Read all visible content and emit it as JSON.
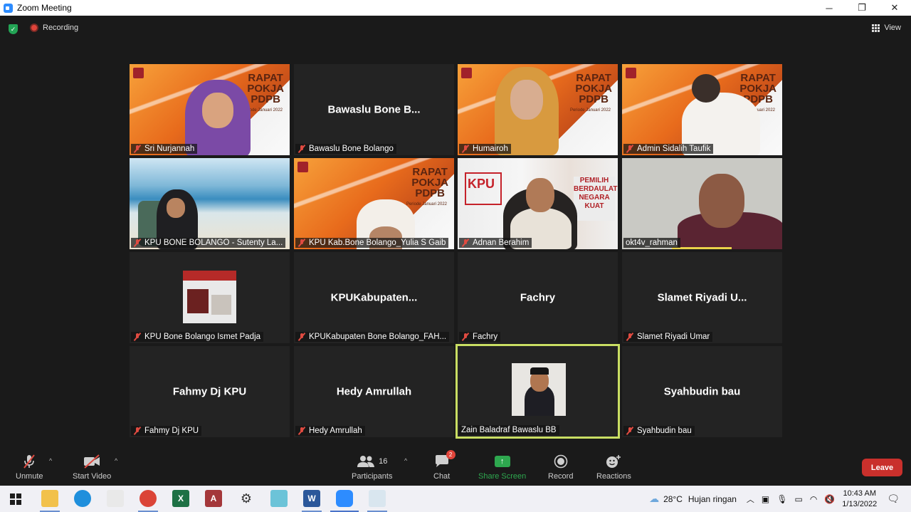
{
  "window": {
    "title": "Zoom Meeting",
    "minimize": "─",
    "maximize": "❐",
    "close": "✕"
  },
  "top": {
    "recording": "Recording",
    "view": "View"
  },
  "tiles": [
    {
      "name": "Sri Nurjannah",
      "banner": "RAPAT\nPOKJA\nPDPB",
      "banner_sub": "Periode Januari 2022"
    },
    {
      "name": "Bawaslu Bone Bolango",
      "center": "Bawaslu Bone B..."
    },
    {
      "name": "Humairoh",
      "banner": "RAPAT\nPOKJA\nPDPB",
      "banner_sub": "Periode Januari 2022"
    },
    {
      "name": "Admin Sidalih Taufik",
      "banner": "RAPAT\nPOKJA\nPDPB",
      "banner_sub": "Periode Januari 2022"
    },
    {
      "name": "KPU BONE BOLANGO - Sutenty La..."
    },
    {
      "name": "KPU Kab.Bone Bolango_Yulia S Gaib",
      "banner": "RAPAT\nPOKJA\nPDPB",
      "banner_sub": "Periode Januari 2022"
    },
    {
      "name": "Adnan Berahim",
      "wall_text": "KPU",
      "wall_text2": "PEMILIH\nBERDAULAT\nNEGARA\nKUAT"
    },
    {
      "name": "okt4v_rahman"
    },
    {
      "name": "KPU Bone Bolango Ismet Padja"
    },
    {
      "name": "KPUKabupaten Bone Bolango_FAH...",
      "center": "KPUKabupaten..."
    },
    {
      "name": "Fachry",
      "center": "Fachry"
    },
    {
      "name": "Slamet Riyadi Umar",
      "center": "Slamet Riyadi U..."
    },
    {
      "name": "Fahmy Dj KPU",
      "center": "Fahmy Dj KPU"
    },
    {
      "name": "Hedy Amrullah",
      "center": "Hedy Amrullah"
    },
    {
      "name": "Zain Baladraf Bawaslu BB"
    },
    {
      "name": "Syahbudin bau",
      "center": "Syahbudin bau"
    }
  ],
  "toolbar": {
    "unmute": "Unmute",
    "start_video": "Start Video",
    "participants": "Participants",
    "participants_count": "16",
    "chat": "Chat",
    "chat_badge": "2",
    "share_screen": "Share Screen",
    "record": "Record",
    "reactions": "Reactions",
    "leave": "Leave",
    "accent_share": "#2ea84f",
    "leave_color": "#c9302c"
  },
  "taskbar": {
    "temperature": "28°C",
    "weather": "Hujan ringan",
    "time": "10:43 AM",
    "date": "1/13/2022"
  }
}
